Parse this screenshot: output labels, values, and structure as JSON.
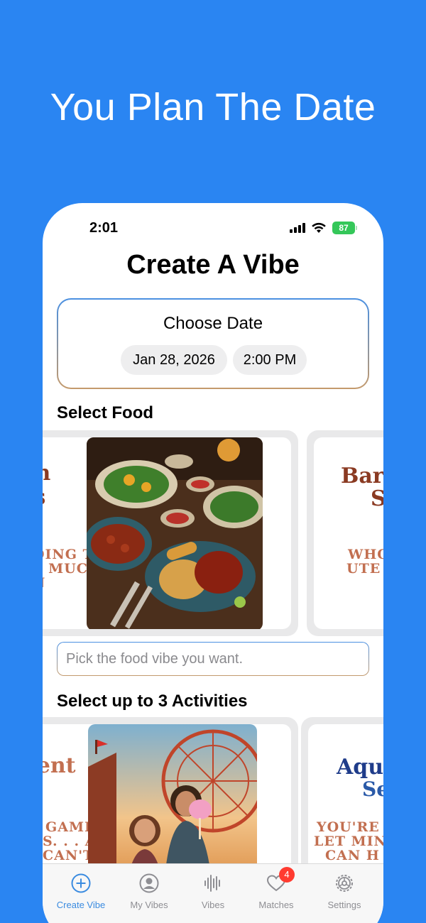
{
  "headline": "You Plan The Date",
  "status_bar": {
    "time": "2:01",
    "battery": "87"
  },
  "app_title": "Create A Vibe",
  "date_card": {
    "title": "Choose Date",
    "date": "Jan 28, 2026",
    "time": "2:00 PM"
  },
  "food": {
    "section_title": "Select Food",
    "cards": [
      {
        "title_lines": [
          "an",
          "ys"
        ],
        "sub_lines": [
          "DING TO",
          "Y MUCH",
          "N"
        ],
        "image": "asian-food-platter-photo"
      },
      {
        "title_lines": [
          "Bar",
          "S"
        ],
        "sub_lines": [
          "WHO",
          "UTE"
        ]
      }
    ],
    "input_placeholder": "Pick the food vibe you want."
  },
  "activities": {
    "section_title": "Select up to 3 Activities",
    "cards": [
      {
        "title_lines": [
          "ment",
          "s"
        ],
        "sub_lines": [
          "GAMES,",
          "S. . . AND",
          "CAN'T"
        ],
        "image": "carnival-couple-photo"
      },
      {
        "title_lines": [
          "Aqu",
          "Se"
        ],
        "sub_lines": [
          "YOU'RE I",
          "LET MIN",
          "CAN H"
        ]
      }
    ]
  },
  "tabs": [
    {
      "label": "Create Vibe",
      "icon": "plus-circle-icon",
      "active": true
    },
    {
      "label": "My Vibes",
      "icon": "person-circle-icon"
    },
    {
      "label": "Vibes",
      "icon": "waveform-icon"
    },
    {
      "label": "Matches",
      "icon": "heart-icon",
      "badge": "4"
    },
    {
      "label": "Settings",
      "icon": "gear-icon"
    }
  ],
  "colors": {
    "background": "#2a85f2",
    "accent": "#3a8be0",
    "poster_title_brown": "#8a3a22",
    "poster_sub": "#c26f50",
    "aquatic_title": "#1f3c8a",
    "badge": "#ff3b30"
  }
}
